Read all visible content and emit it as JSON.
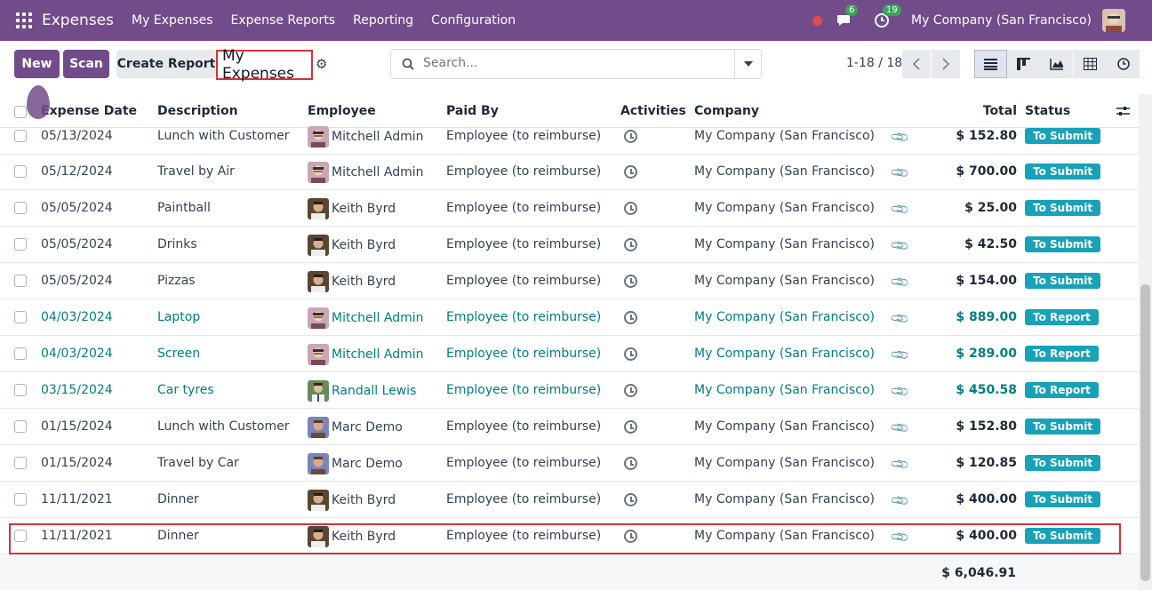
{
  "navbar": {
    "brand": "Expenses",
    "menu": [
      "My Expenses",
      "Expense Reports",
      "Reporting",
      "Configuration"
    ],
    "messages_count": "6",
    "activities_count": "19",
    "company": "My Company (San Francisco)"
  },
  "control": {
    "new_label": "New",
    "scan_label": "Scan",
    "create_report_label": "Create Report",
    "title": "My Expenses",
    "search_placeholder": "Search...",
    "pager": "1-18 / 18"
  },
  "columns": {
    "date": "Expense Date",
    "description": "Description",
    "employee": "Employee",
    "paid_by": "Paid By",
    "activities": "Activities",
    "company": "Company",
    "total": "Total",
    "status": "Status"
  },
  "rows": [
    {
      "date": "05/13/2024",
      "description": "Lunch with Customer",
      "employee": "Mitchell Admin",
      "avatar": "mitchell",
      "paid_by": "Employee (to reimburse)",
      "company": "My Company (San Francisco)",
      "total": "$ 152.80",
      "status": "To Submit",
      "linked": false
    },
    {
      "date": "05/12/2024",
      "description": "Travel by Air",
      "employee": "Mitchell Admin",
      "avatar": "mitchell",
      "paid_by": "Employee (to reimburse)",
      "company": "My Company (San Francisco)",
      "total": "$ 700.00",
      "status": "To Submit",
      "linked": false
    },
    {
      "date": "05/05/2024",
      "description": "Paintball",
      "employee": "Keith Byrd",
      "avatar": "keith",
      "paid_by": "Employee (to reimburse)",
      "company": "My Company (San Francisco)",
      "total": "$ 25.00",
      "status": "To Submit",
      "linked": false
    },
    {
      "date": "05/05/2024",
      "description": "Drinks",
      "employee": "Keith Byrd",
      "avatar": "keith",
      "paid_by": "Employee (to reimburse)",
      "company": "My Company (San Francisco)",
      "total": "$ 42.50",
      "status": "To Submit",
      "linked": false
    },
    {
      "date": "05/05/2024",
      "description": "Pizzas",
      "employee": "Keith Byrd",
      "avatar": "keith",
      "paid_by": "Employee (to reimburse)",
      "company": "My Company (San Francisco)",
      "total": "$ 154.00",
      "status": "To Submit",
      "linked": false
    },
    {
      "date": "04/03/2024",
      "description": "Laptop",
      "employee": "Mitchell Admin",
      "avatar": "mitchell",
      "paid_by": "Employee (to reimburse)",
      "company": "My Company (San Francisco)",
      "total": "$ 889.00",
      "status": "To Report",
      "linked": true
    },
    {
      "date": "04/03/2024",
      "description": "Screen",
      "employee": "Mitchell Admin",
      "avatar": "mitchell",
      "paid_by": "Employee (to reimburse)",
      "company": "My Company (San Francisco)",
      "total": "$ 289.00",
      "status": "To Report",
      "linked": true
    },
    {
      "date": "03/15/2024",
      "description": "Car tyres",
      "employee": "Randall Lewis",
      "avatar": "randall",
      "paid_by": "Employee (to reimburse)",
      "company": "My Company (San Francisco)",
      "total": "$ 450.58",
      "status": "To Report",
      "linked": true
    },
    {
      "date": "01/15/2024",
      "description": "Lunch with Customer",
      "employee": "Marc Demo",
      "avatar": "marc",
      "paid_by": "Employee (to reimburse)",
      "company": "My Company (San Francisco)",
      "total": "$ 152.80",
      "status": "To Submit",
      "linked": false
    },
    {
      "date": "01/15/2024",
      "description": "Travel by Car",
      "employee": "Marc Demo",
      "avatar": "marc",
      "paid_by": "Employee (to reimburse)",
      "company": "My Company (San Francisco)",
      "total": "$ 120.85",
      "status": "To Submit",
      "linked": false
    },
    {
      "date": "11/11/2021",
      "description": "Dinner",
      "employee": "Keith Byrd",
      "avatar": "keith",
      "paid_by": "Employee (to reimburse)",
      "company": "My Company (San Francisco)",
      "total": "$ 400.00",
      "status": "To Submit",
      "linked": false
    },
    {
      "date": "11/11/2021",
      "description": "Dinner",
      "employee": "Keith Byrd",
      "avatar": "keith",
      "paid_by": "Employee (to reimburse)",
      "company": "My Company (San Francisco)",
      "total": "$ 400.00",
      "status": "To Submit",
      "linked": false
    }
  ],
  "grand_total": "$ 6,046.91",
  "colors": {
    "brand": "#714b8a",
    "link": "#017e84",
    "status_badge": "#17a2b8",
    "highlight": "#d0343c"
  }
}
